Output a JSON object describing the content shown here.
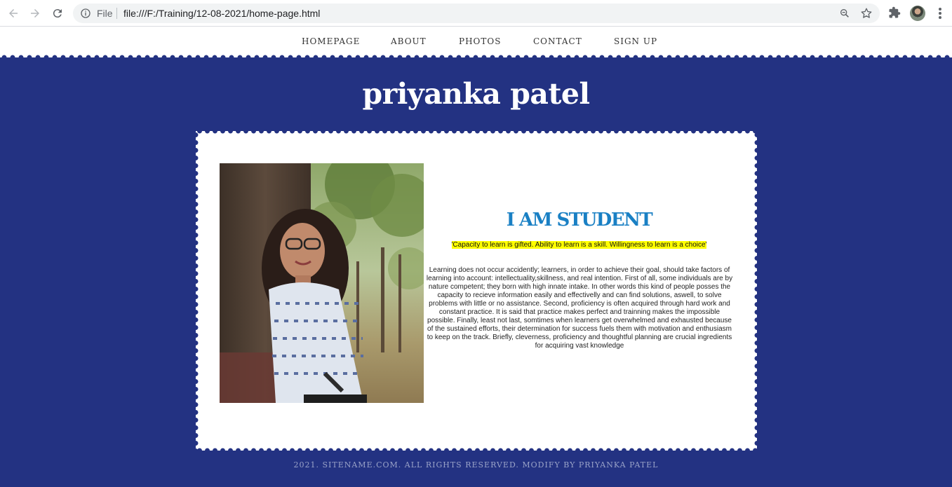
{
  "browser": {
    "scheme_label": "File",
    "url": "file:///F:/Training/12-08-2021/home-page.html"
  },
  "nav": {
    "items": [
      {
        "label": "HOMEPAGE"
      },
      {
        "label": "ABOUT"
      },
      {
        "label": "PHOTOS"
      },
      {
        "label": "CONTACT"
      },
      {
        "label": "SIGN UP"
      }
    ]
  },
  "header": {
    "title": "priyanka patel"
  },
  "content": {
    "heading": "I AM STUDENT",
    "quote": "'Capacity to learn is gifted. Ability to learn is a skill. Willingness to learn is a choice'",
    "paragraph": "Learning does not occur accidently; learners, in order to achieve their goal, should take factors of learning into account: intellectuality,skillness, and real intention. First of all, some individuals are by nature competent; they born with high innate intake. In other words this kind of people posses the capacity to recieve information easily and effectivelly and can find solutions, aswell, to solve problems with little or no assistance. Second, proficiency is often acquired through hard work and constant practice. It is said that practice makes perfect and trainning makes the impossible possible. Finally, least not last, somtimes when learners get overwhelmed and exhausted because of the sustained efforts, their determination for success fuels them with motivation and enthusiasm to keep on the track. Briefly, cleverness, proficiency and thoughtful planning are crucial ingredients for acquiring vast knowledge"
  },
  "footer": {
    "text": "2021. SITENAME.COM. ALL RIGHTS RESERVED. MODIFY BY PRIYANKA PATEL"
  },
  "colors": {
    "page_background": "#233282",
    "heading": "#1a80c4",
    "quote_highlight": "#ffff00",
    "card": "#ffffff"
  },
  "icons": [
    "back-arrow-icon",
    "forward-arrow-icon",
    "reload-icon",
    "info-icon",
    "zoom-icon",
    "star-icon",
    "extensions-icon",
    "profile-avatar",
    "more-menu-icon"
  ]
}
